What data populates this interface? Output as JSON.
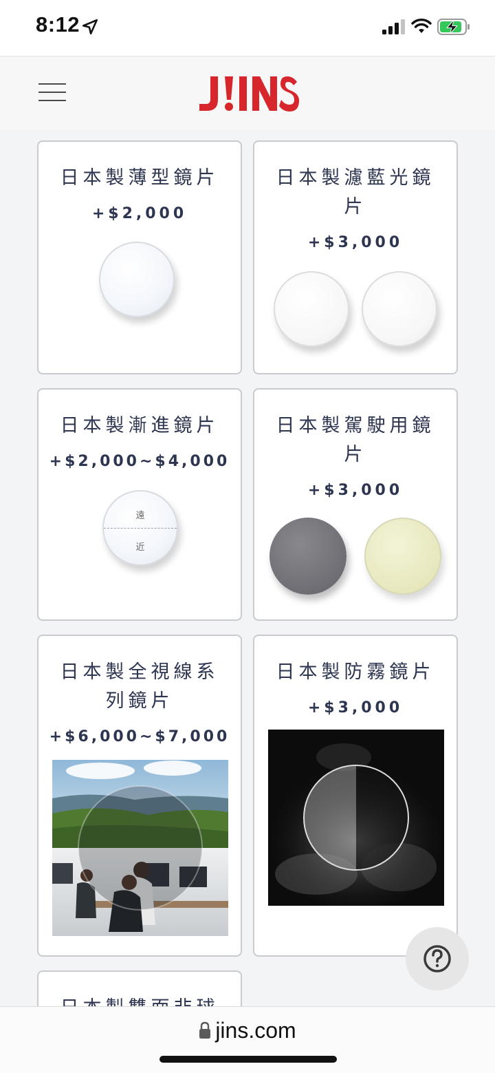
{
  "status_bar": {
    "time": "8:12",
    "icons": [
      "location-arrow-icon",
      "signal-icon",
      "wifi-icon",
      "battery-charging-icon"
    ]
  },
  "header": {
    "logo_text": "J!NS",
    "brand_color": "#d7262c",
    "menu_icon": "hamburger-menu-icon"
  },
  "cards": [
    {
      "title": "日本製薄型鏡片",
      "price": "+$2,000"
    },
    {
      "title_line1": "日本製濾藍光鏡",
      "title_line2": "片",
      "price": "+$3,000"
    },
    {
      "title": "日本製漸進鏡片",
      "price": "+$2,000~$4,000",
      "far_label": "遠",
      "near_label": "近"
    },
    {
      "title_line1": "日本製駕駛用鏡",
      "title_line2": "片",
      "price": "+$3,000"
    },
    {
      "title_line1": "日本製全視線系",
      "title_line2": "列鏡片",
      "price": "+$6,000~$7,000"
    },
    {
      "title": "日本製防霧鏡片",
      "price": "+$3,000"
    },
    {
      "title": "日本製雙面非球"
    }
  ],
  "help_button": {
    "icon": "question-circle-icon"
  },
  "address_bar": {
    "url": "jins.com",
    "icon": "lock-icon"
  }
}
